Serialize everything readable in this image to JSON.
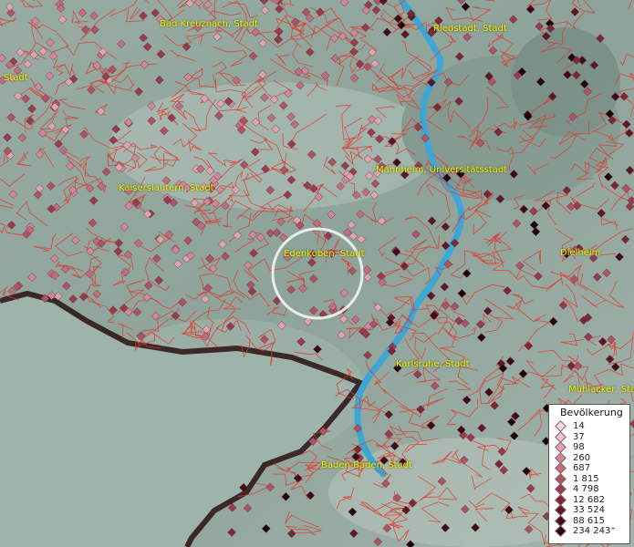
{
  "map": {
    "colors": {
      "terrain_light": "#a8bbb2",
      "terrain_mid": "#8ea39a",
      "terrain_dark": "#6f8880",
      "boundary": "#e0392b",
      "river": "#3ea6d4",
      "border": "#201010"
    },
    "labels": [
      {
        "id": "bad-kreuznach",
        "text": "Bad Kreuznach, Stadt"
      },
      {
        "id": "riedstadt",
        "text": "Riedstadt, Stadt"
      },
      {
        "id": "stadt-left",
        "text": "Stadt"
      },
      {
        "id": "mannheim",
        "text": "Mannheim, Universitätsstadt"
      },
      {
        "id": "kaiserslautern",
        "text": "Kaiserslautern, Stadt"
      },
      {
        "id": "edenkoben",
        "text": "Edenkoben, Stadt"
      },
      {
        "id": "dielheim",
        "text": "Dielheim"
      },
      {
        "id": "karlsruhe",
        "text": "Karlsruhe, Stadt"
      },
      {
        "id": "muehlacker",
        "text": "Mühlacker, Stadt"
      },
      {
        "id": "baden-baden",
        "text": "Baden-Baden, Stadt"
      }
    ]
  },
  "legend": {
    "title": "Bevölkerung",
    "items": [
      {
        "label": "14",
        "color": "#f5dde3"
      },
      {
        "label": "37",
        "color": "#ecc2cc"
      },
      {
        "label": "98",
        "color": "#dea5b1"
      },
      {
        "label": "260",
        "color": "#d08897"
      },
      {
        "label": "687",
        "color": "#c06d7e"
      },
      {
        "label": "1 815",
        "color": "#ad5366"
      },
      {
        "label": "4 798",
        "color": "#963c4e"
      },
      {
        "label": "12 682",
        "color": "#7a2838"
      },
      {
        "label": "33 524",
        "color": "#5c1826"
      },
      {
        "label": "88 615",
        "color": "#3d0c17"
      },
      {
        "label": "234 243⁺",
        "color": "#1f040a"
      }
    ]
  }
}
